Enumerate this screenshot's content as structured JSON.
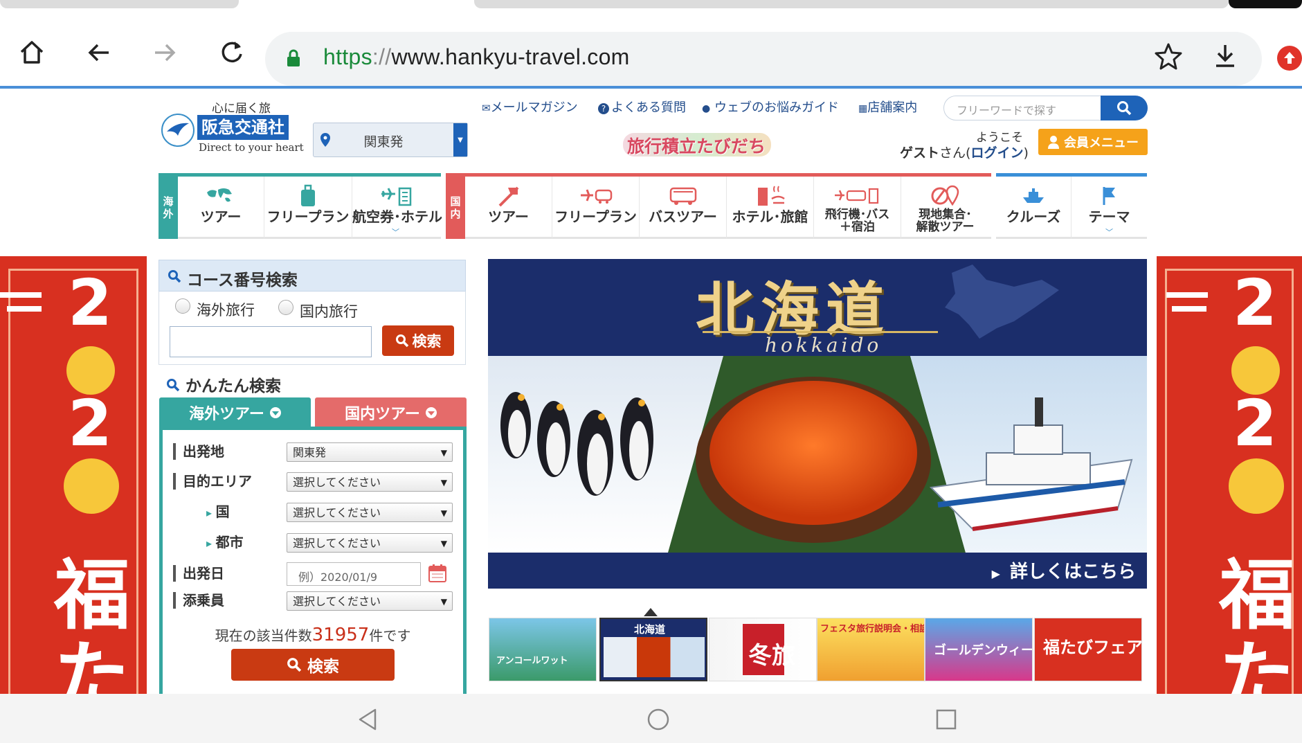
{
  "browser": {
    "url_scheme": "https",
    "url_sep": "://",
    "url_host": "www.hankyu-travel.com",
    "icons": [
      "home-icon",
      "back-icon",
      "forward-icon",
      "reload-icon",
      "lock-icon",
      "star-icon",
      "download-icon",
      "update-icon"
    ]
  },
  "header": {
    "logo_tagline": "心に届く旅",
    "logo_brand": "阪急交通社",
    "logo_sub": "Direct to your heart",
    "depart_label": "関東発",
    "links": [
      "メールマガジン",
      "よくある質問",
      "ウェブのお悩みガイド",
      "店舗案内"
    ],
    "search_placeholder": "フリーワードで探す",
    "tabidachi": "旅行積立たびだち",
    "welcome": "ようこそ",
    "guest": "ゲスト",
    "guest_suffix": "さん(",
    "login": "ログイン",
    "guest_close": ")",
    "member_menu": "会員メニュー"
  },
  "nav": {
    "intl_tag": [
      "海",
      "外"
    ],
    "intl": [
      "ツアー",
      "フリープラン",
      "航空券･ホテル"
    ],
    "dom_tag": [
      "国",
      "内"
    ],
    "dom": [
      "ツアー",
      "フリープラン",
      "バスツアー",
      "ホテル･旅館"
    ],
    "dom_multi": [
      [
        "飛行機･バス",
        "＋宿泊"
      ],
      [
        "現地集合･",
        "解散ツアー"
      ]
    ],
    "other": [
      "クルーズ",
      "テーマ"
    ]
  },
  "side_banner": {
    "num1": "2",
    "num2": "2",
    "kanji1": "福",
    "kanji2": "た"
  },
  "code_search": {
    "title": "コース番号検索",
    "radio_intl": "海外旅行",
    "radio_dom": "国内旅行",
    "input_value": "",
    "button": "検索"
  },
  "easy_search": {
    "title": "かんたん検索",
    "tab_intl": "海外ツアー",
    "tab_dom": "国内ツアー",
    "rows": {
      "departure": {
        "label": "出発地",
        "value": "関東発"
      },
      "area": {
        "label": "目的エリア",
        "value": "選択してください"
      },
      "country": {
        "label": "国",
        "value": "選択してください"
      },
      "city": {
        "label": "都市",
        "value": "選択してください"
      },
      "date": {
        "label": "出発日",
        "placeholder": "例）2020/01/9"
      },
      "escort": {
        "label": "添乗員",
        "value": "選択してください"
      }
    },
    "count_prefix": "現在の該当件数",
    "count": "31957",
    "count_suffix": "件です",
    "button": "検索"
  },
  "hero": {
    "title": "北海道",
    "subtitle": "hokkaido",
    "more": "詳しくはこちら"
  },
  "thumbs": [
    {
      "text": "アンコールワット",
      "color": "#2f8f6e"
    },
    {
      "text": "北海道",
      "color": "#1b2d6b"
    },
    {
      "text": "冬旅",
      "color": "#c8202a"
    },
    {
      "text": "フェスタ旅行説明会・相談会",
      "color": "#f0c020"
    },
    {
      "text": "ゴールデンウィーク",
      "color": "#3a78c8"
    },
    {
      "text": "福たびフェア",
      "color": "#d83020"
    }
  ],
  "colors": {
    "brand_blue": "#1e63b8",
    "intl_teal": "#36a6a0",
    "dom_red": "#e25b5a",
    "cta_red": "#c93a12",
    "member_orange": "#f5a21a",
    "hero_navy": "#1b2d6b"
  }
}
